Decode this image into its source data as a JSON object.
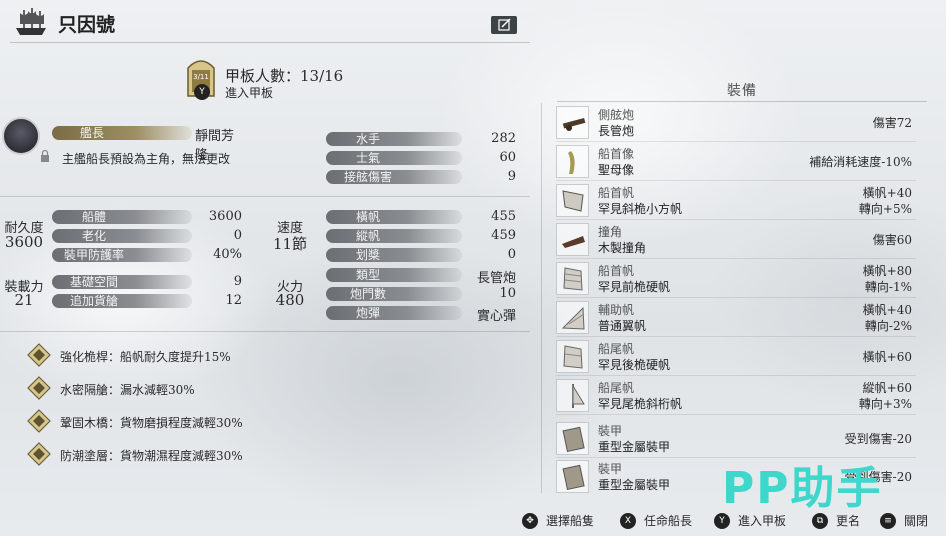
{
  "header": {
    "title": "只因號",
    "edit_icon": "edit-icon"
  },
  "deck": {
    "badge": "3/11",
    "title": "甲板人數：13/16",
    "subtitle": "進入甲板",
    "button": "Y"
  },
  "captain": {
    "label": "艦長",
    "name": "靜間芳隆",
    "note": "主艦船長預設為主角，無法更改"
  },
  "crew_stats": [
    {
      "label": "水手",
      "value": "282"
    },
    {
      "label": "士氣",
      "value": "60"
    },
    {
      "label": "接舷傷害",
      "value": "9"
    }
  ],
  "durability": {
    "label": "耐久度",
    "value": "3600",
    "rows": [
      {
        "label": "船體",
        "value": "3600"
      },
      {
        "label": "老化",
        "value": "0"
      },
      {
        "label": "裝甲防護率",
        "value": "40%"
      }
    ]
  },
  "speed": {
    "label": "速度",
    "value": "11節",
    "rows": [
      {
        "label": "橫帆",
        "value": "455"
      },
      {
        "label": "縱帆",
        "value": "459"
      },
      {
        "label": "划槳",
        "value": "0"
      }
    ]
  },
  "capacity": {
    "label": "裝載力",
    "value": "21",
    "rows": [
      {
        "label": "基礎空間",
        "value": "9"
      },
      {
        "label": "追加貨艙",
        "value": "12"
      }
    ]
  },
  "firepower": {
    "label": "火力",
    "value": "480",
    "rows": [
      {
        "label": "類型",
        "value": "長管炮"
      },
      {
        "label": "炮門數",
        "value": "10"
      },
      {
        "label": "炮彈",
        "value": "實心彈"
      }
    ]
  },
  "perks": [
    {
      "text": "強化桅桿：船帆耐久度提升15%"
    },
    {
      "text": "水密隔艙：漏水減輕30%"
    },
    {
      "text": "鞏固木橋：貨物磨損程度減輕30%"
    },
    {
      "text": "防潮塗層：貨物潮濕程度減輕30%"
    }
  ],
  "equipment": {
    "title": "裝備",
    "items": [
      {
        "category": "側舷炮",
        "name": "長管炮",
        "stat1": "傷害72",
        "stat2": ""
      },
      {
        "category": "船首像",
        "name": "聖母像",
        "stat1": "補給消耗速度-10%",
        "stat2": ""
      },
      {
        "category": "船首帆",
        "name": "罕見斜桅小方帆",
        "stat1": "橫帆+40",
        "stat2": "轉向+5%"
      },
      {
        "category": "撞角",
        "name": "木製撞角",
        "stat1": "傷害60",
        "stat2": ""
      },
      {
        "category": "船首帆",
        "name": "罕見前桅硬帆",
        "stat1": "橫帆+80",
        "stat2": "轉向-1%"
      },
      {
        "category": "輔助帆",
        "name": "普通翼帆",
        "stat1": "橫帆+40",
        "stat2": "轉向-2%"
      },
      {
        "category": "船尾帆",
        "name": "罕見後桅硬帆",
        "stat1": "橫帆+60",
        "stat2": ""
      },
      {
        "category": "船尾帆",
        "name": "罕見尾桅斜桁帆",
        "stat1": "縱帆+60",
        "stat2": "轉向+3%"
      },
      {
        "category": "裝甲",
        "name": "重型金屬裝甲",
        "stat1": "受到傷害-20",
        "stat2": ""
      },
      {
        "category": "裝甲",
        "name": "重型金屬裝甲",
        "stat1": "受到傷害-20",
        "stat2": ""
      }
    ]
  },
  "bottom_bar": [
    {
      "key": "✥",
      "label": "選擇船隻"
    },
    {
      "key": "X",
      "label": "任命船長"
    },
    {
      "key": "Y",
      "label": "進入甲板"
    },
    {
      "key": "⧉",
      "label": "更名"
    },
    {
      "key": "≡",
      "label": "關閉"
    }
  ],
  "watermark": "PP助手"
}
